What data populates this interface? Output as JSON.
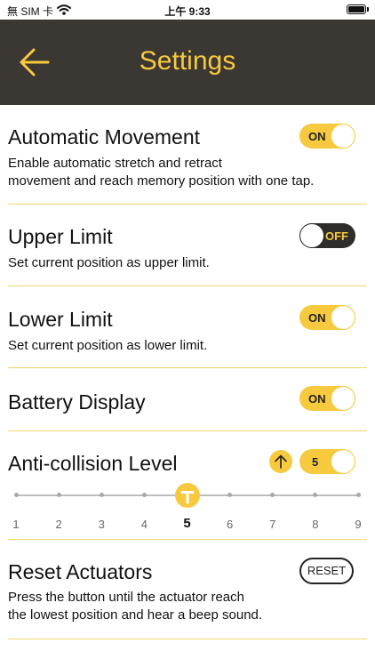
{
  "status_bar": {
    "carrier": "無 SIM 卡",
    "time": "上午 9:33",
    "icons": [
      "wifi-icon",
      "battery-icon"
    ]
  },
  "header": {
    "title": "Settings",
    "back_icon": "arrow-left-icon"
  },
  "colors": {
    "header_bg": "#3b3833",
    "accent": "#f7c93e",
    "toggle_off_bg": "#2f2d2a",
    "divider": "#f2d66e"
  },
  "settings": {
    "automatic_movement": {
      "title": "Automatic Movement",
      "desc_line1": "Enable automatic stretch and retract",
      "desc_line2": "movement and reach memory position with one tap.",
      "toggle_label": "ON",
      "state": "on"
    },
    "upper_limit": {
      "title": "Upper Limit",
      "desc": "Set current position as upper limit.",
      "toggle_label": "OFF",
      "state": "off"
    },
    "lower_limit": {
      "title": "Lower Limit",
      "desc": "Set current position as lower limit.",
      "toggle_label": "ON",
      "state": "on"
    },
    "battery_display": {
      "title": "Battery Display",
      "toggle_label": "ON",
      "state": "on"
    },
    "anti_collision": {
      "title": "Anti-collision Level",
      "up_icon": "arrow-up-icon",
      "value_label": "5",
      "slider": {
        "levels": [
          "1",
          "2",
          "3",
          "4",
          "5",
          "6",
          "7",
          "8",
          "9"
        ],
        "value": 5,
        "min": 1,
        "max": 9
      }
    },
    "reset_actuators": {
      "title": "Reset Actuators",
      "button_label": "RESET",
      "desc_line1": "Press the button until the actuator reach",
      "desc_line2": "the lowest position and hear a beep sound."
    }
  }
}
